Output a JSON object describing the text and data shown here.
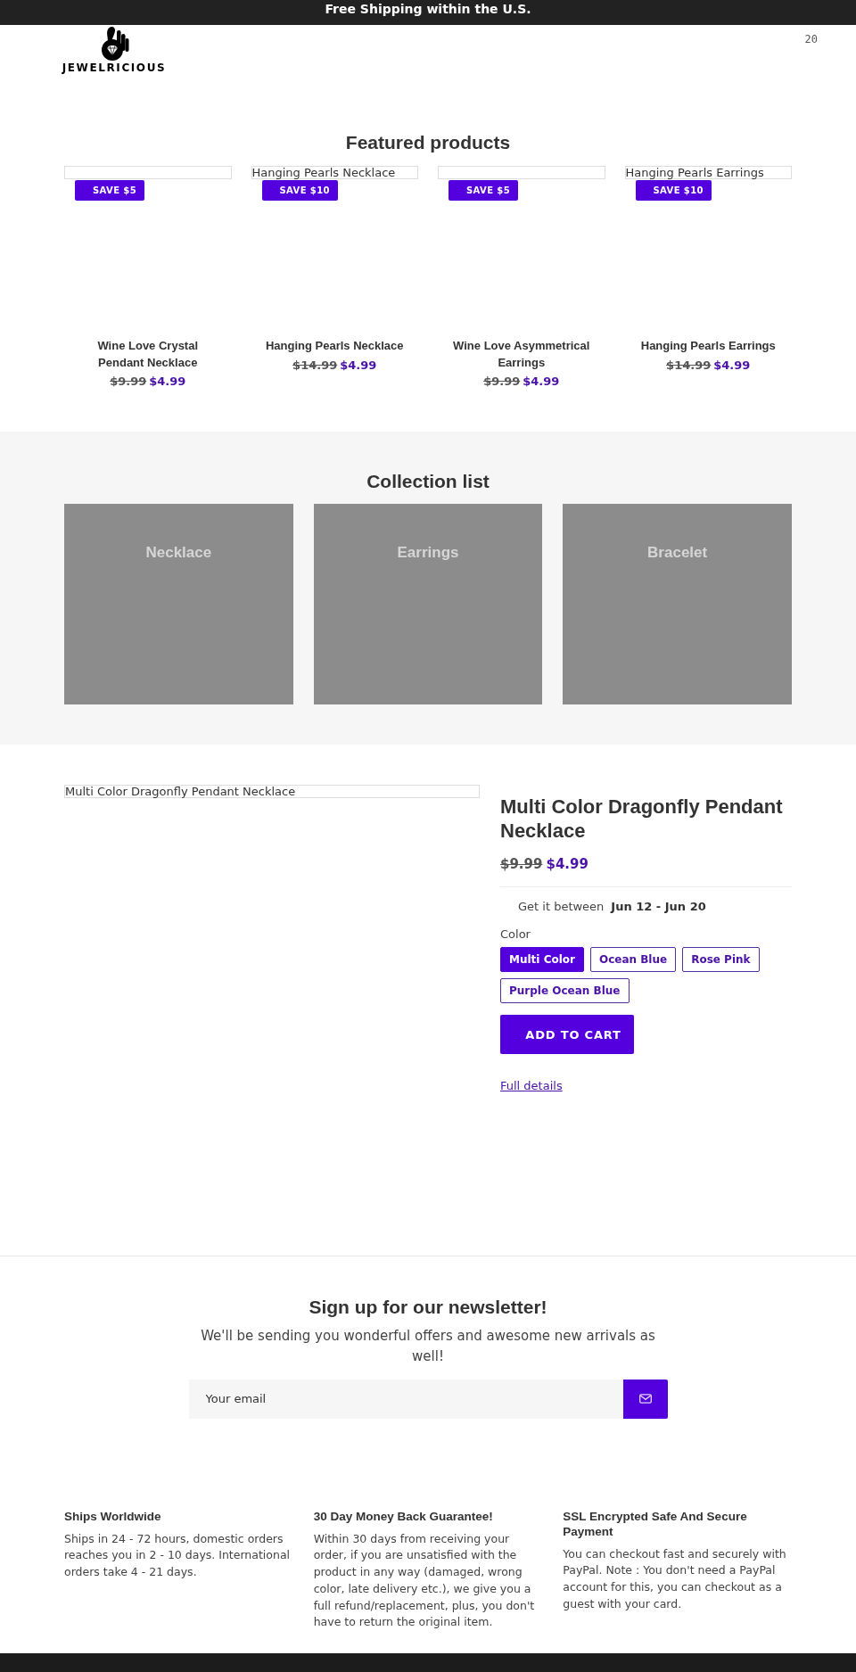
{
  "announcement": {
    "text": "Free Shipping within the U.S."
  },
  "header": {
    "logo_text": "JEWELRICIOUS",
    "cart_count": "20"
  },
  "featured": {
    "title": "Featured products",
    "products": [
      {
        "badge": "SAVE $5",
        "name": "Wine Love Crystal Pendant Necklace",
        "compare_price": "$9.99",
        "price": "$4.99"
      },
      {
        "image_alt": "Hanging Pearls Necklace",
        "badge": "SAVE $10",
        "name": "Hanging Pearls Necklace",
        "compare_price": "$14.99",
        "price": "$4.99"
      },
      {
        "badge": "SAVE $5",
        "name": "Wine Love Asymmetrical Earrings",
        "compare_price": "$9.99",
        "price": "$4.99"
      },
      {
        "image_alt": "Hanging Pearls Earrings",
        "badge": "SAVE $10",
        "name": "Hanging Pearls Earrings",
        "compare_price": "$14.99",
        "price": "$4.99"
      }
    ]
  },
  "collections": {
    "title": "Collection list",
    "items": [
      {
        "label": "Necklace"
      },
      {
        "label": "Earrings"
      },
      {
        "label": "Bracelet"
      }
    ]
  },
  "product": {
    "image_alt": "Multi Color Dragonfly Pendant Necklace",
    "title": "Multi Color Dragonfly Pendant Necklace",
    "compare_price": "$9.99",
    "price": "$4.99",
    "delivery": {
      "label": "Get it between",
      "dates": "Jun 12 - Jun 20"
    },
    "option_label": "Color",
    "options": [
      {
        "label": "Multi Color",
        "selected": true
      },
      {
        "label": "Ocean Blue",
        "selected": false
      },
      {
        "label": "Rose Pink",
        "selected": false
      },
      {
        "label": "Purple Ocean Blue",
        "selected": false
      }
    ],
    "add_to_cart": "ADD TO CART",
    "details_link": "Full details"
  },
  "newsletter": {
    "title": "Sign up for our newsletter!",
    "subtitle": "We'll be sending you wonderful offers and awesome new arrivals as well!",
    "placeholder": "Your email"
  },
  "features": [
    {
      "title": "Ships Worldwide",
      "text": "Ships in 24 - 72 hours, domestic orders reaches you in 2 - 10 days. International orders take 4 - 21 days."
    },
    {
      "title": "30 Day Money Back Guarantee!",
      "text": "Within 30 days from receiving your order, if you are unsatisfied with the product in any way (damaged, wrong color, late delivery etc.), we give you a full refund/replacement, plus, you don't have to return the original item."
    },
    {
      "title": "SSL Encrypted Safe And Secure Payment",
      "text": "You can checkout fast and securely with PayPal. Note : You don't need a PayPal account for this, you can checkout as a guest with your card."
    }
  ]
}
